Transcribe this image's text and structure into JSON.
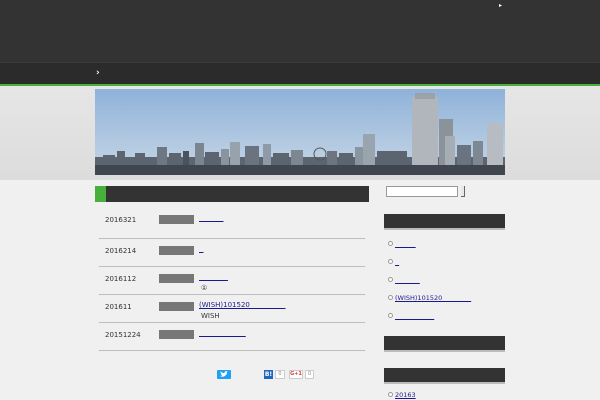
{
  "header": {
    "top_icon": "▸",
    "nav_chevron": "›"
  },
  "posts": [
    {
      "date": "2016321",
      "title": "           ",
      "excerpt": ""
    },
    {
      "date": "2016214",
      "title": "  ",
      "excerpt": ""
    },
    {
      "date": "2016112",
      "title": "             ",
      "excerpt": "①"
    },
    {
      "date": "201611",
      "title": "(WISH)101520                ",
      "excerpt": "WISH"
    },
    {
      "date": "20151224",
      "title": "                     ",
      "excerpt": ""
    }
  ],
  "share": {
    "twitter_icon": "twitter-bird-icon",
    "hatena_label": "B!",
    "hatena_count": "0",
    "gplus_label": "G+1",
    "gplus_count": "0"
  },
  "sidebar": {
    "search_placeholder": "",
    "recent_posts": [
      {
        "label": "          "
      },
      {
        "label": "  "
      },
      {
        "label": "            "
      },
      {
        "label": "(WISH)101520              "
      },
      {
        "label": "                   "
      }
    ],
    "archives": [
      {
        "label": "20163"
      }
    ]
  },
  "colors": {
    "accent": "#46b03a",
    "dark_bar": "#333333",
    "link": "#1a1a8c"
  }
}
